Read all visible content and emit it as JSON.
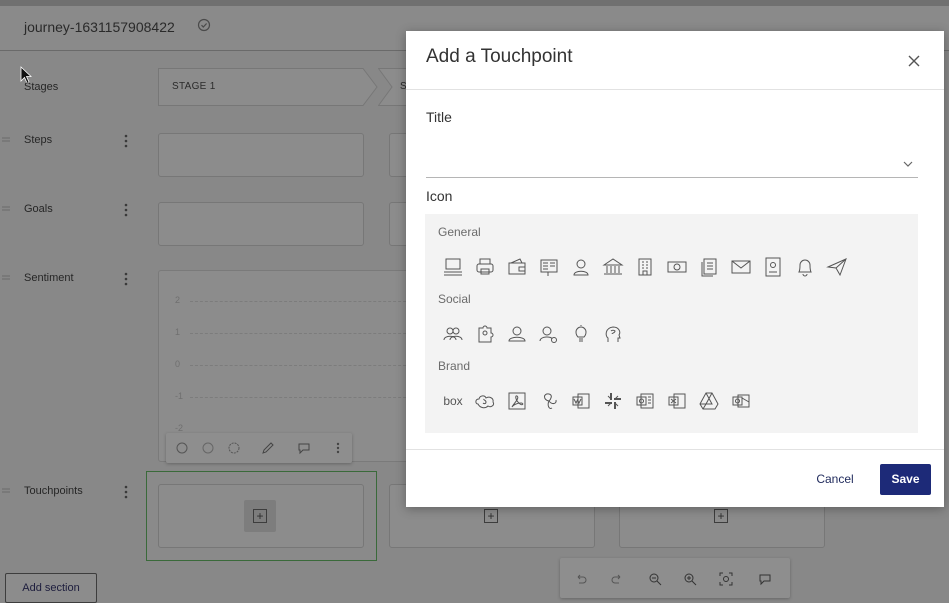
{
  "journey": {
    "title": "journey-1631157908422"
  },
  "rows": {
    "stages": "Stages",
    "steps": "Steps",
    "goals": "Goals",
    "sentiment": "Sentiment",
    "touchpoints": "Touchpoints"
  },
  "stage": {
    "stage1": "STAGE 1",
    "stage2_partial": "S"
  },
  "sentiment_axis": [
    "2",
    "1",
    "0",
    "-1",
    "-2"
  ],
  "add_section_label": "Add section",
  "modal": {
    "title": "Add a Touchpoint",
    "title_field_label": "Title",
    "title_value": "",
    "icon_field_label": "Icon",
    "groups": {
      "general": "General",
      "social": "Social",
      "brand": "Brand"
    },
    "brand_box_text": "box",
    "cancel_label": "Cancel",
    "save_label": "Save"
  },
  "icons": {
    "general": [
      "desktop-icon",
      "printer-icon",
      "wallet-icon",
      "receipt-icon",
      "person-icon",
      "bank-icon",
      "office-building-icon",
      "cash-icon",
      "documents-icon",
      "mail-icon",
      "contact-card-icon",
      "bell-icon",
      "paper-plane-icon"
    ],
    "social": [
      "group-icon",
      "puzzle-person-icon",
      "team-icon",
      "person-settings-icon",
      "lightbulb-icon",
      "head-brain-icon"
    ],
    "brand": [
      "box-brand-icon",
      "salesforce-icon",
      "adobe-acrobat-icon",
      "fan-logo-icon",
      "word-icon",
      "slack-icon",
      "onenote-icon",
      "excel-icon",
      "google-drive-icon",
      "outlook-icon"
    ]
  },
  "colors": {
    "primary": "#1d2a78",
    "overlay": "#888888",
    "panel": "#f3f3f3"
  }
}
